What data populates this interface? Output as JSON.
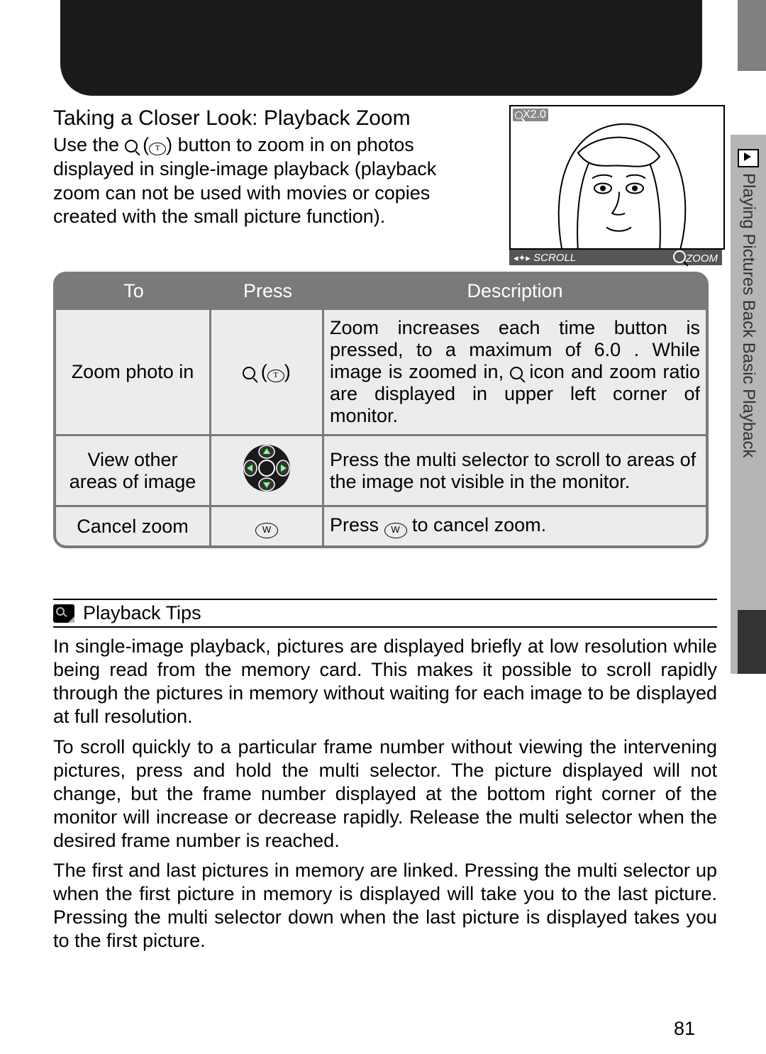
{
  "sidebar": {
    "label": "Playing Pictures Back Basic Playback"
  },
  "section": {
    "heading": "Taking a Closer Look: Playback Zoom",
    "intro_a": "Use the",
    "intro_b": " button to zoom in on photos displayed in single-image playback (playback zoom can not be used with movies or copies created with the small picture function)."
  },
  "illustration": {
    "zoom_label": "X2.0",
    "bottom_left": "SCROLL",
    "bottom_right": "ZOOM"
  },
  "table": {
    "headers": {
      "c1": "To",
      "c2": "Press",
      "c3": "Description"
    },
    "rows": [
      {
        "to": "Zoom photo in",
        "desc_a": "Zoom increases each time button is pressed, to a maximum of 6.0 .  While image is zoomed in, ",
        "desc_b": " icon and zoom ratio are displayed in upper left corner of monitor."
      },
      {
        "to": "View other areas of image",
        "desc": "Press the multi selector to scroll to areas of the image not visible in the monitor."
      },
      {
        "to": "Cancel zoom",
        "desc_a": "Press ",
        "desc_b": " to cancel zoom."
      }
    ]
  },
  "tips": {
    "title": "Playback Tips",
    "p1": "In single-image playback, pictures are displayed briefly at low resolution while being read from the memory card.  This makes it possible to scroll rapidly through the pictures in memory without waiting for each image to be displayed at full resolution.",
    "p2": "To scroll quickly to a particular frame number without viewing the intervening pictures, press and hold the multi selector.  The picture displayed will not change, but the frame number displayed at the bottom right corner of the monitor will increase or decrease rapidly.  Release the multi selector when the desired frame number is reached.",
    "p3": "The first and last pictures in memory are linked.  Pressing the multi selector up when the first picture in memory is displayed will take you to the last picture.  Pressing the multi selector down when the last picture is displayed takes you to the first picture."
  },
  "page_number": "81"
}
